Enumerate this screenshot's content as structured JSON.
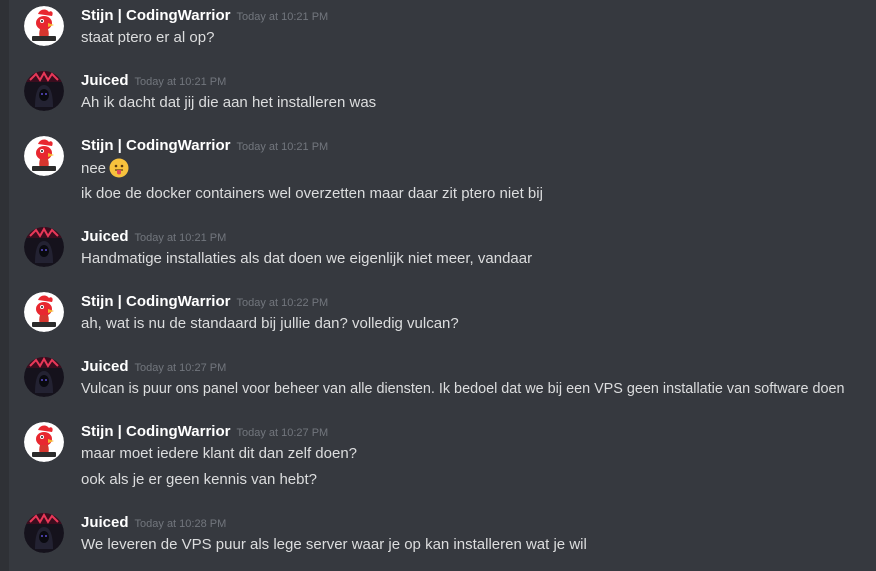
{
  "messages": [
    {
      "author": "Stijn | CodingWarrior",
      "avatar_icon": "rooster-avatar-icon",
      "timestamp": "Today at 10:21 PM",
      "lines": [
        {
          "text": "staat ptero er al op?"
        }
      ]
    },
    {
      "author": "Juiced",
      "avatar_icon": "hooded-figure-avatar-icon",
      "timestamp": "Today at 10:21 PM",
      "lines": [
        {
          "text": "Ah ik dacht dat jij die aan het installeren was"
        }
      ]
    },
    {
      "author": "Stijn | CodingWarrior",
      "avatar_icon": "rooster-avatar-icon",
      "timestamp": "Today at 10:21 PM",
      "lines": [
        {
          "text": "nee",
          "emoji": "tongue-out-emoji-icon"
        },
        {
          "text": "ik doe de docker containers wel overzetten maar daar zit ptero niet bij"
        }
      ]
    },
    {
      "author": "Juiced",
      "avatar_icon": "hooded-figure-avatar-icon",
      "timestamp": "Today at 10:21 PM",
      "lines": [
        {
          "text": "Handmatige installaties als dat doen we eigenlijk niet meer, vandaar"
        }
      ]
    },
    {
      "author": "Stijn | CodingWarrior",
      "avatar_icon": "rooster-avatar-icon",
      "timestamp": "Today at 10:22 PM",
      "lines": [
        {
          "text": "ah, wat is nu de standaard bij jullie dan? volledig vulcan?"
        }
      ]
    },
    {
      "author": "Juiced",
      "avatar_icon": "hooded-figure-avatar-icon",
      "timestamp": "Today at 10:27 PM",
      "lines": [
        {
          "text": "Vulcan is puur ons panel voor beheer van alle diensten. Ik bedoel dat we bij een VPS geen installatie van software doen"
        }
      ]
    },
    {
      "author": "Stijn | CodingWarrior",
      "avatar_icon": "rooster-avatar-icon",
      "timestamp": "Today at 10:27 PM",
      "lines": [
        {
          "text": "maar moet iedere klant dit dan zelf doen?"
        },
        {
          "text": "ook als je er geen kennis van hebt?"
        }
      ]
    },
    {
      "author": "Juiced",
      "avatar_icon": "hooded-figure-avatar-icon",
      "timestamp": "Today at 10:28 PM",
      "lines": [
        {
          "text": "We leveren de VPS puur als lege server waar je op kan installeren wat je wil"
        }
      ]
    }
  ],
  "colors": {
    "background": "#36393f",
    "username": "#ffffff",
    "message_text": "#dcddde",
    "timestamp": "#72767d"
  }
}
